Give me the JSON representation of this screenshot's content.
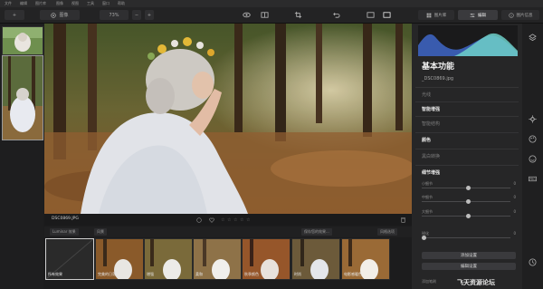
{
  "menu": [
    "文件",
    "编辑",
    "图片库",
    "图像",
    "视图",
    "工具",
    "窗口",
    "帮助"
  ],
  "toolbar": {
    "add_label": "+",
    "photo_button": "图像",
    "zoom": "73%",
    "zoom_minus": "−",
    "zoom_plus": "+",
    "tabs": [
      {
        "label": "图片库",
        "active": false
      },
      {
        "label": "编辑",
        "active": true
      },
      {
        "label": "图片信息",
        "active": false
      }
    ]
  },
  "photo": {
    "filename": "DSC0869.JPG",
    "rating_stars": 5
  },
  "looks_bar": {
    "collection": "Luminar 效果",
    "filter": "风景",
    "save_label": "保存您的效果...",
    "manage_label": "风格选项"
  },
  "looks": [
    {
      "label": "所有效果",
      "active": true
    },
    {
      "label": "完美的日落",
      "active": false
    },
    {
      "label": "增强",
      "active": false
    },
    {
      "label": "柔和",
      "active": false
    },
    {
      "label": "秋季颜色",
      "active": false
    },
    {
      "label": "时尚",
      "active": false
    },
    {
      "label": "电影感暖色",
      "active": false
    }
  ],
  "panel": {
    "title": "基本功能",
    "file": "_DSC0869.jpg",
    "sections": [
      {
        "label": "光线",
        "bright": false
      },
      {
        "label": "智能增强",
        "bright": true
      },
      {
        "label": "智能结构",
        "bright": false
      },
      {
        "label": "颜色",
        "bright": true
      },
      {
        "label": "黑白转换",
        "bright": false
      },
      {
        "label": "细节增强",
        "bright": true
      }
    ],
    "sliders": [
      {
        "label": "小细节",
        "value": "0"
      },
      {
        "label": "中细节",
        "value": "0"
      },
      {
        "label": "大细节",
        "value": "0"
      },
      {
        "label": "锐化",
        "value": "0"
      }
    ],
    "buttons": [
      "添加设置",
      "编辑设置"
    ],
    "bottom_label": "添加笔刷"
  },
  "watermark": "飞天资源论坛",
  "colors": {
    "accent": "#d0d0d0",
    "histogram_blue": "#3f67c8",
    "histogram_teal": "#6fd0c8"
  }
}
